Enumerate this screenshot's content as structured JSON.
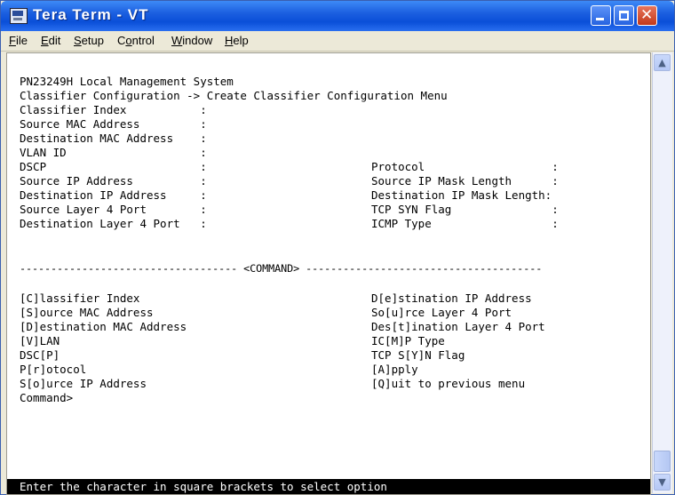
{
  "window": {
    "title": "Tera Term - VT",
    "buttons": {
      "minimize_icon": "minimize-icon",
      "maximize_icon": "maximize-icon",
      "close_glyph": "✕"
    }
  },
  "menubar": {
    "items": [
      {
        "label": "File",
        "underline_index": 0
      },
      {
        "label": "Edit",
        "underline_index": 0
      },
      {
        "label": "Setup",
        "underline_index": 0
      },
      {
        "label": "Control",
        "underline_index": 1
      },
      {
        "label": "Window",
        "underline_index": 0
      },
      {
        "label": "Help",
        "underline_index": 0
      }
    ]
  },
  "terminal": {
    "header": [
      "PN23249H Local Management System",
      "Classifier Configuration -> Create Classifier Configuration Menu"
    ],
    "fields_left": [
      "Classifier Index           :",
      "Source MAC Address         :",
      "Destination MAC Address    :",
      "VLAN ID                    :",
      "DSCP                       :",
      "Source IP Address          :",
      "Destination IP Address     :",
      "Source Layer 4 Port        :",
      "Destination Layer 4 Port   :"
    ],
    "fields_right": [
      "Protocol                   :",
      "Source IP Mask Length      :",
      "Destination IP Mask Length:",
      "TCP SYN Flag               :",
      "ICMP Type                  :"
    ],
    "command_divider": "----------------------------------- <COMMAND> --------------------------------------",
    "commands_left": [
      "[C]lassifier Index",
      "[S]ource MAC Address",
      "[D]estination MAC Address",
      "[V]LAN",
      "DSC[P]",
      "P[r]otocol",
      "S[o]urce IP Address"
    ],
    "commands_right": [
      "D[e]stination IP Address",
      "So[u]rce Layer 4 Port",
      "Des[t]ination Layer 4 Port",
      "IC[M]P Type",
      "TCP S[Y]N Flag",
      "[A]pply",
      "[Q]uit to previous menu"
    ],
    "prompt": "Command>",
    "status": "Enter the character in square brackets to select option"
  },
  "colors": {
    "titlebar": "#1c5fe0",
    "terminal_bg": "#ffffff",
    "status_bg": "#000000",
    "status_fg": "#ffffff"
  }
}
